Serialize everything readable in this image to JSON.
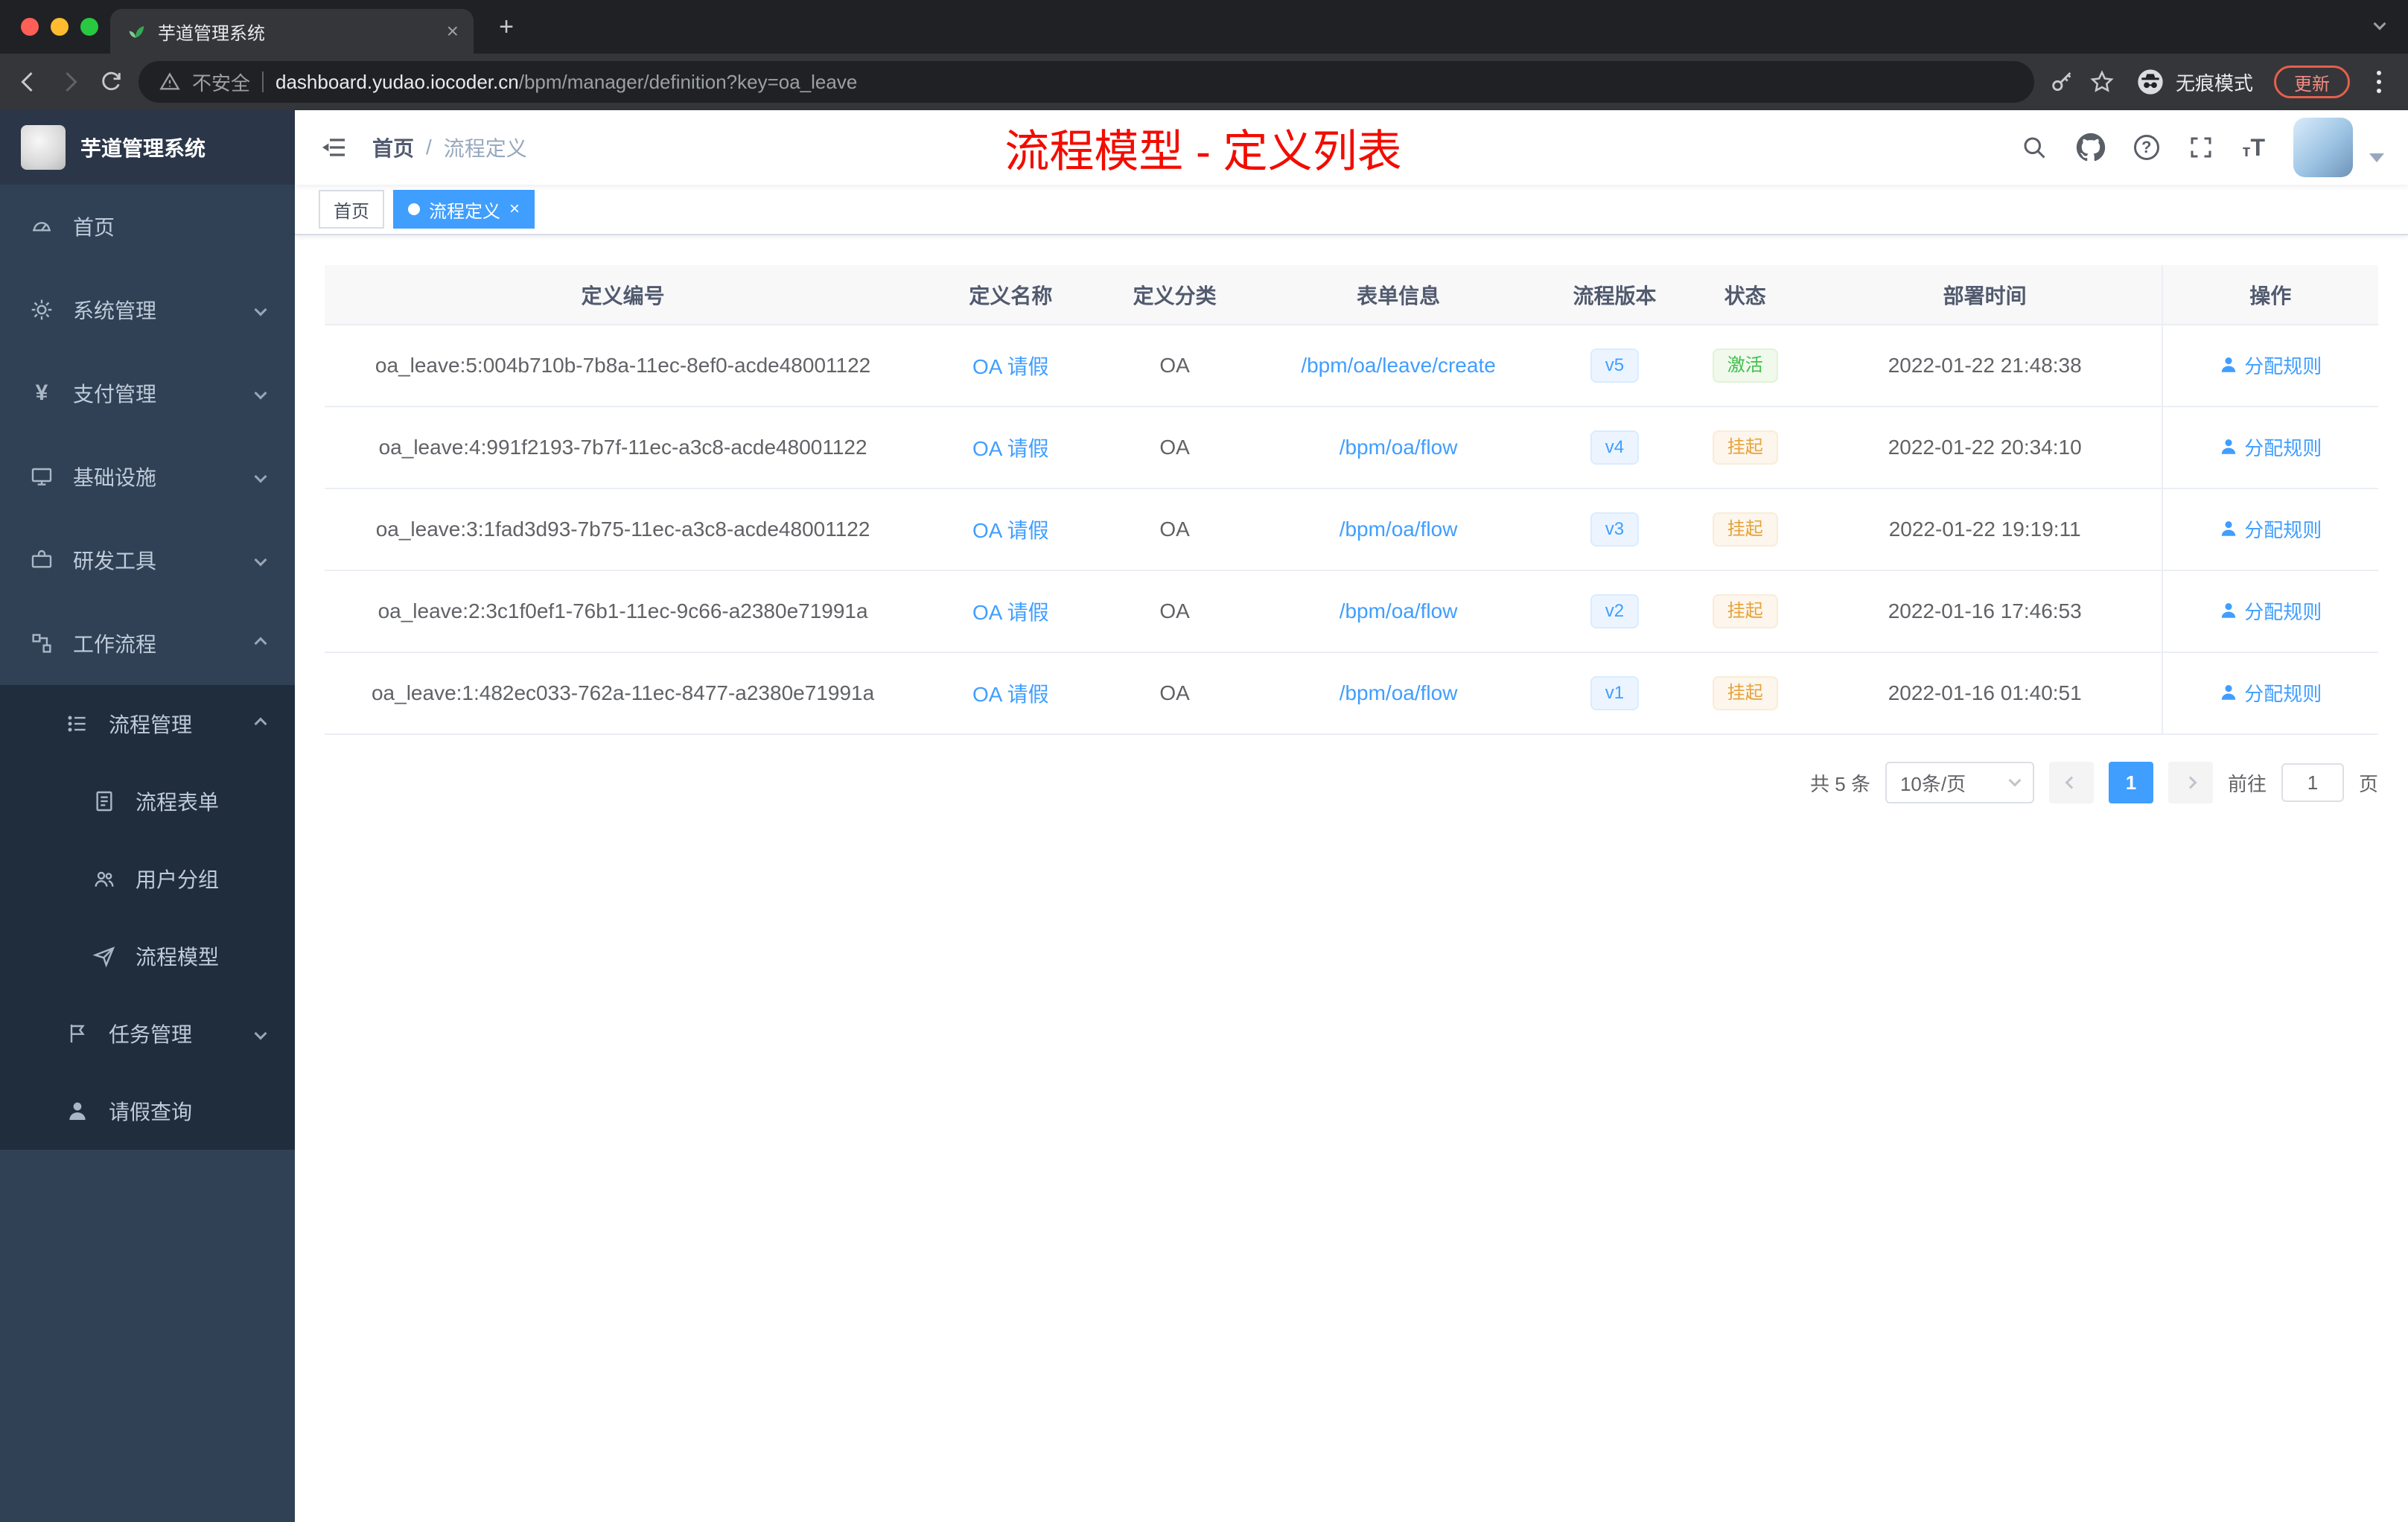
{
  "browser": {
    "tab_title": "芋道管理系统",
    "security_label": "不安全",
    "url_domain": "dashboard.yudao.iocoder.cn",
    "url_path": "/bpm/manager/definition?key=oa_leave",
    "incognito_label": "无痕模式",
    "update_label": "更新"
  },
  "sidebar": {
    "logo_title": "芋道管理系统",
    "menu": [
      {
        "label": "首页"
      },
      {
        "label": "系统管理"
      },
      {
        "label": "支付管理"
      },
      {
        "label": "基础设施"
      },
      {
        "label": "研发工具"
      },
      {
        "label": "工作流程"
      }
    ],
    "submenu": [
      {
        "label": "流程管理"
      },
      {
        "label": "流程表单"
      },
      {
        "label": "用户分组"
      },
      {
        "label": "流程模型"
      },
      {
        "label": "任务管理"
      },
      {
        "label": "请假查询"
      }
    ]
  },
  "header": {
    "breadcrumb_home": "首页",
    "breadcrumb_separator": "/",
    "breadcrumb_current": "流程定义",
    "banner": "流程模型 - 定义列表"
  },
  "tags": {
    "home": "首页",
    "active": "流程定义"
  },
  "table": {
    "columns": [
      "定义编号",
      "定义名称",
      "定义分类",
      "表单信息",
      "流程版本",
      "状态",
      "部署时间",
      "操作"
    ],
    "rows": [
      {
        "id": "oa_leave:5:004b710b-7b8a-11ec-8ef0-acde48001122",
        "name": "OA 请假",
        "category": "OA",
        "form": "/bpm/oa/leave/create",
        "version": "v5",
        "status": "激活",
        "status_type": "success",
        "deployed": "2022-01-22 21:48:38",
        "action": "分配规则"
      },
      {
        "id": "oa_leave:4:991f2193-7b7f-11ec-a3c8-acde48001122",
        "name": "OA 请假",
        "category": "OA",
        "form": "/bpm/oa/flow",
        "version": "v4",
        "status": "挂起",
        "status_type": "warning",
        "deployed": "2022-01-22 20:34:10",
        "action": "分配规则"
      },
      {
        "id": "oa_leave:3:1fad3d93-7b75-11ec-a3c8-acde48001122",
        "name": "OA 请假",
        "category": "OA",
        "form": "/bpm/oa/flow",
        "version": "v3",
        "status": "挂起",
        "status_type": "warning",
        "deployed": "2022-01-22 19:19:11",
        "action": "分配规则"
      },
      {
        "id": "oa_leave:2:3c1f0ef1-76b1-11ec-9c66-a2380e71991a",
        "name": "OA 请假",
        "category": "OA",
        "form": "/bpm/oa/flow",
        "version": "v2",
        "status": "挂起",
        "status_type": "warning",
        "deployed": "2022-01-16 17:46:53",
        "action": "分配规则"
      },
      {
        "id": "oa_leave:1:482ec033-762a-11ec-8477-a2380e71991a",
        "name": "OA 请假",
        "category": "OA",
        "form": "/bpm/oa/flow",
        "version": "v1",
        "status": "挂起",
        "status_type": "warning",
        "deployed": "2022-01-16 01:40:51",
        "action": "分配规则"
      }
    ]
  },
  "pagination": {
    "total": "共 5 条",
    "page_size": "10条/页",
    "page": "1",
    "goto_label": "前往",
    "goto_value": "1",
    "goto_unit": "页"
  },
  "colors": {
    "accent": "#409eff",
    "banner_red": "#f20c00",
    "success": "#67c23a",
    "warning": "#e6a23c",
    "sidebar_bg": "#304156",
    "submenu_bg": "#1f2d3d"
  }
}
